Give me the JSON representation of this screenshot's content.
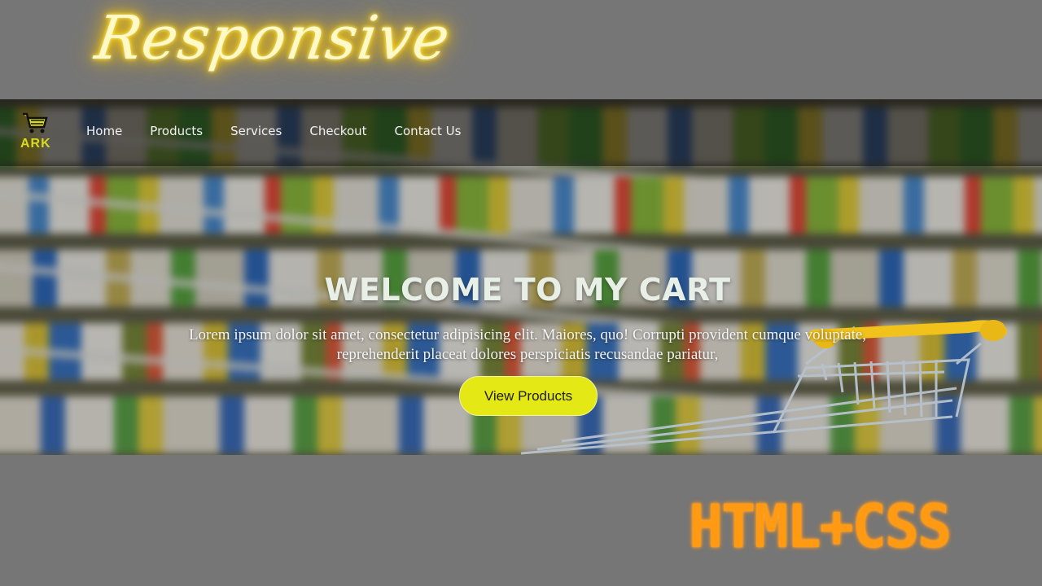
{
  "promo": {
    "top_script": "Responsive",
    "bottom_tag": "HTML+CSS"
  },
  "navbar": {
    "logo_text": "ARK",
    "logo_icon": "shopping-cart-icon",
    "links": [
      "Home",
      "Products",
      "Services",
      "Checkout",
      "Contact Us"
    ]
  },
  "hero": {
    "title": "WELCOME TO MY CART",
    "text_line1": "Lorem ipsum dolor sit amet, consectetur adipisicing elit. Maiores, quo! Corrupti provident cumque voluptate,",
    "text_line2": "reprehenderit placeat dolores perspiciatis recusandae pariatur,",
    "cta_label": "View Products"
  },
  "colors": {
    "page_background": "#767676",
    "accent_yellow": "#e4e814",
    "neon_yellow": "#ffe86a",
    "promo_orange": "#ff9a12"
  }
}
